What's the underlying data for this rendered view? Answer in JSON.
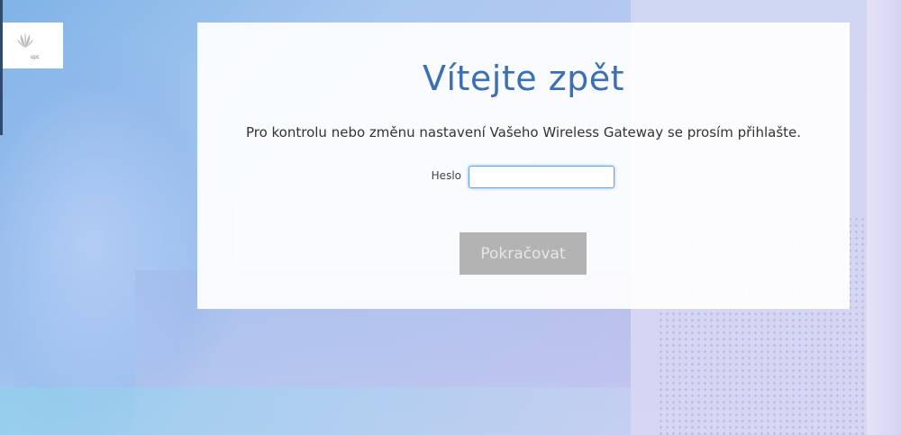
{
  "brand": {
    "logo_text": "upc",
    "logo_icon": "upc-spark-icon"
  },
  "login": {
    "title": "Vítejte zpět",
    "subtitle": "Pro kontrolu nebo změnu nastavení Vašeho Wireless Gateway se prosím přihlašte.",
    "password_label": "Heslo",
    "password_value": "",
    "continue_label": "Pokračovat",
    "continue_enabled": false
  },
  "colors": {
    "title": "#3d6fb5",
    "button_disabled_bg": "#b3b3b3",
    "button_disabled_text": "#e6e6e6",
    "input_focus_border": "#6aa3e6"
  }
}
